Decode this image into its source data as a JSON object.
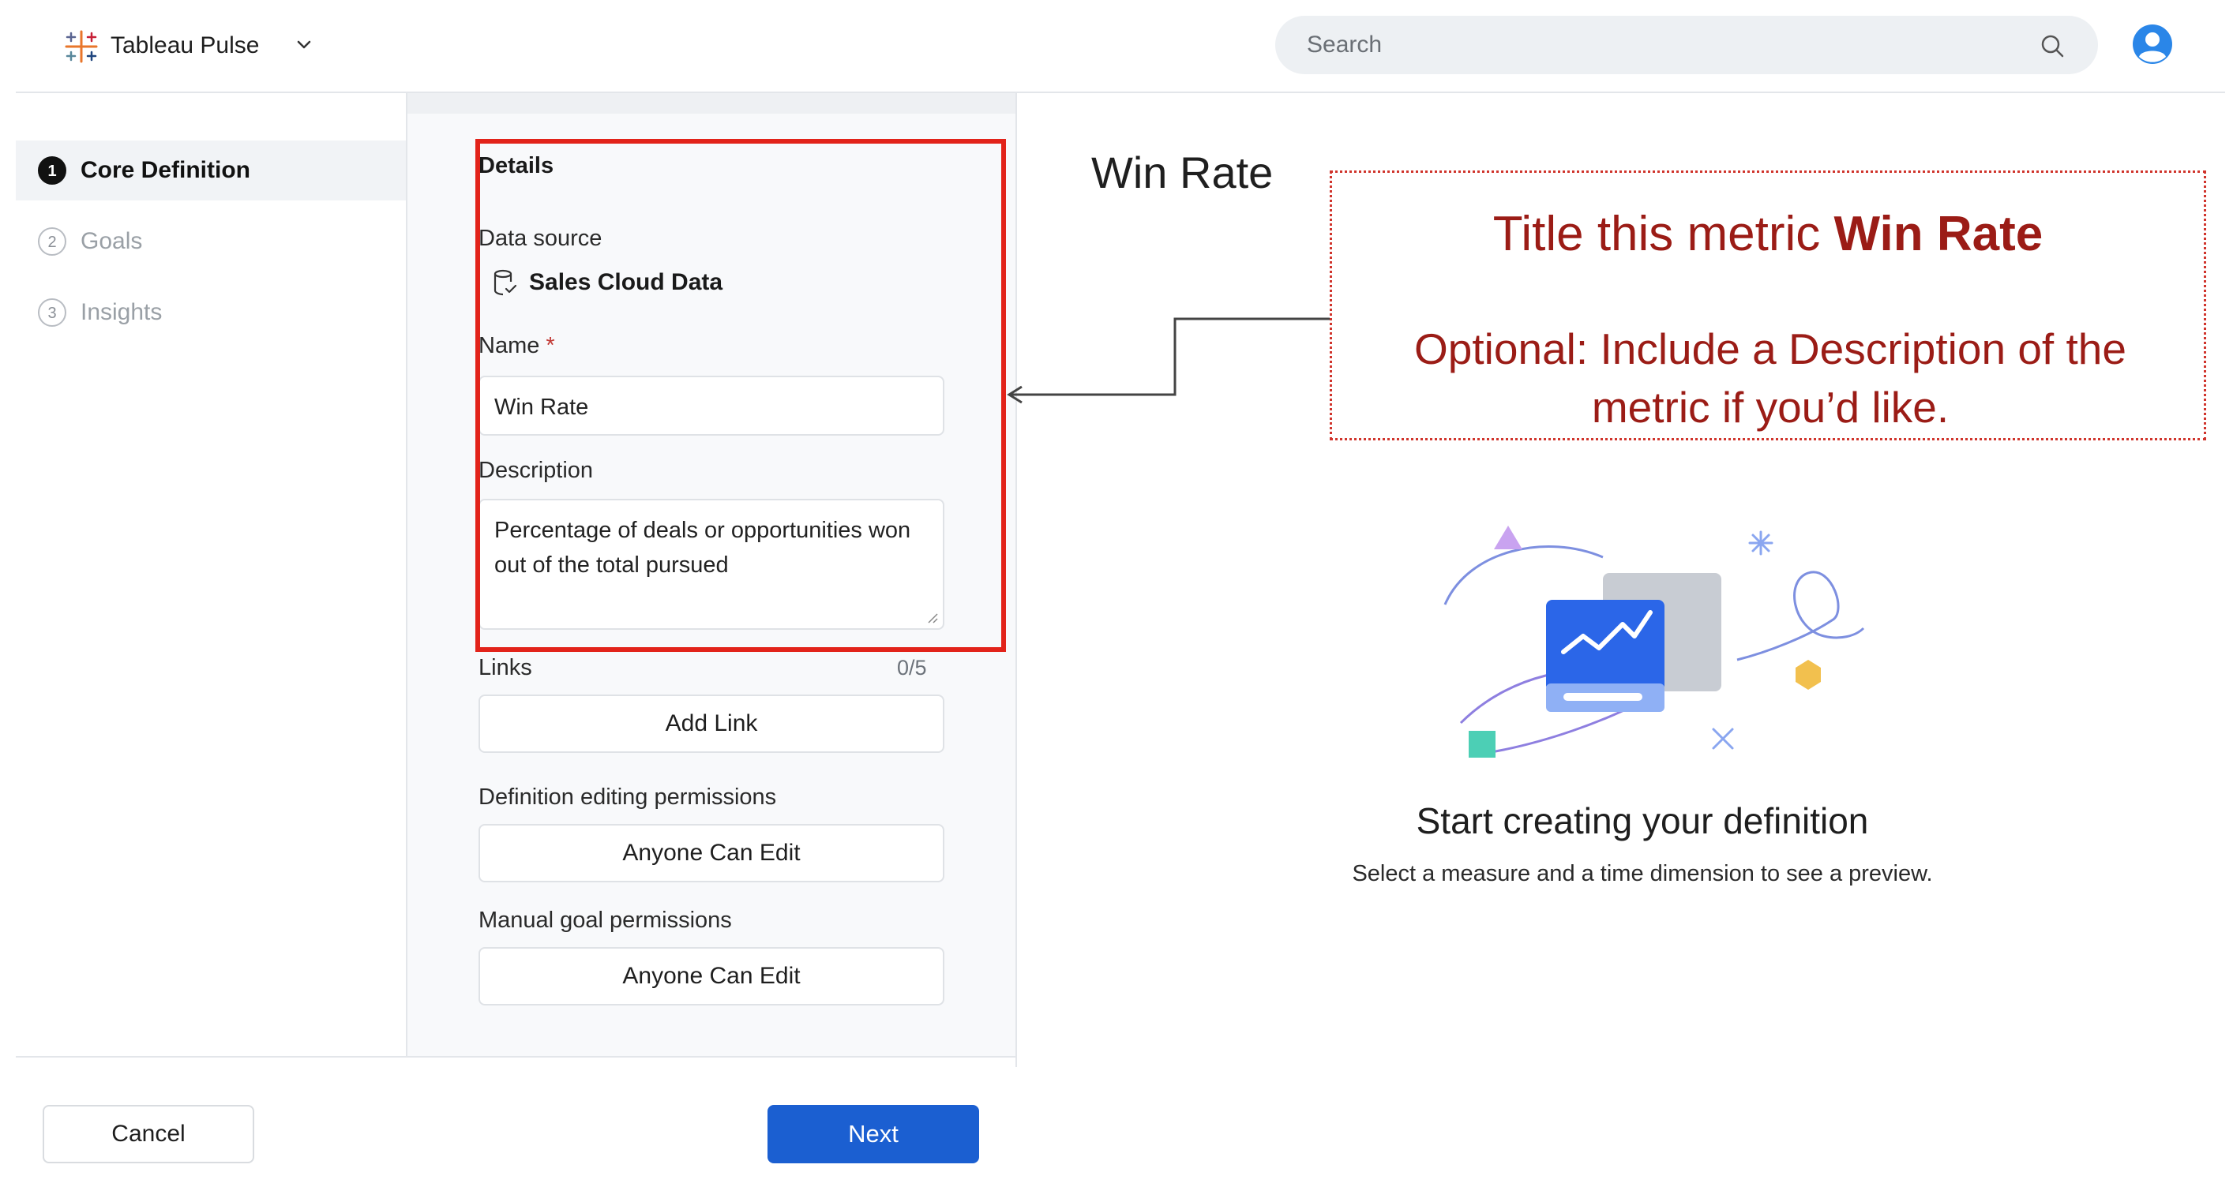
{
  "header": {
    "app_name": "Tableau Pulse",
    "search_placeholder": "Search"
  },
  "sidebar": {
    "steps": [
      {
        "number": "1",
        "label": "Core Definition",
        "active": true
      },
      {
        "number": "2",
        "label": "Goals",
        "active": false
      },
      {
        "number": "3",
        "label": "Insights",
        "active": false
      }
    ]
  },
  "form": {
    "section_title": "Details",
    "data_source_label": "Data source",
    "data_source_value": "Sales Cloud Data",
    "name_label": "Name",
    "name_required_mark": "*",
    "name_value": "Win Rate",
    "description_label": "Description",
    "description_value": "Percentage of deals or opportunities won out of the total pursued",
    "links_label": "Links",
    "links_counter": "0/5",
    "add_link_label": "Add Link",
    "definition_permissions_label": "Definition editing permissions",
    "definition_permissions_value": "Anyone Can Edit",
    "goal_permissions_label": "Manual goal permissions",
    "goal_permissions_value": "Anyone Can Edit"
  },
  "footer": {
    "cancel_label": "Cancel",
    "next_label": "Next"
  },
  "preview": {
    "title": "Win Rate",
    "empty_title": "Start creating your definition",
    "empty_subtitle": "Select a measure and a time dimension to see a preview."
  },
  "annotation": {
    "line1_prefix": "Title this metric ",
    "line1_bold": "Win Rate",
    "line2": "Optional: Include a Description of the metric if you’d like."
  },
  "colors": {
    "highlight_border": "#e2231a",
    "annotation_text": "#9b1c16",
    "primary_button": "#1b5fd1",
    "required_mark": "#c23934"
  }
}
